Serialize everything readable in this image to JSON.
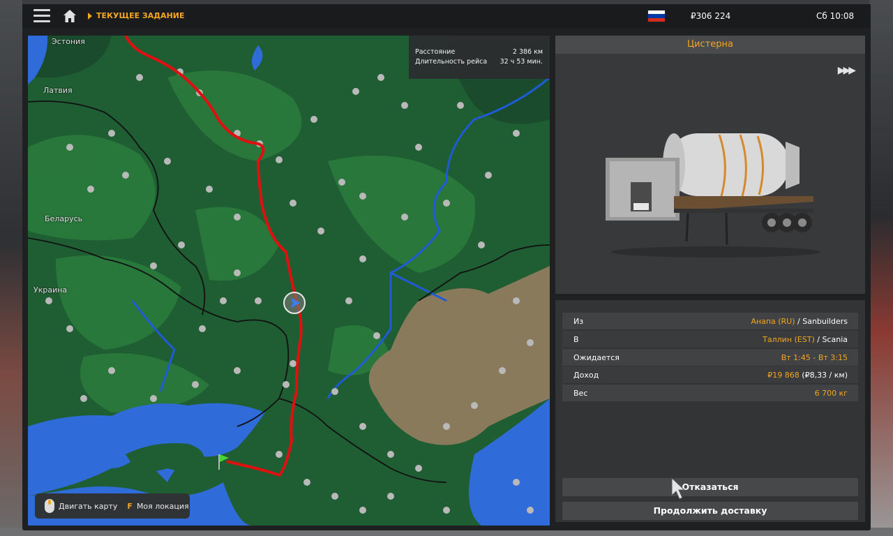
{
  "topbar": {
    "breadcrumb": "ТЕКУЩЕЕ ЗАДАНИЕ",
    "money": "₽306 224",
    "clock": "Сб 10:08",
    "flag_colors": [
      "#ffffff",
      "#0039a6",
      "#d52b1e"
    ]
  },
  "map": {
    "labels": {
      "estonia": "Эстония",
      "latvia": "Латвия",
      "belarus": "Беларусь",
      "ukraine": "Украина"
    },
    "info": {
      "distance_label": "Расстояние",
      "distance_value": "2 386 км",
      "duration_label": "Длительность рейса",
      "duration_value": "32 ч 53 мин."
    },
    "controls": {
      "move_label": "Двигать карту",
      "key": "F",
      "location_label": "Моя локация"
    },
    "colors": {
      "land": "#1f5d33",
      "water": "#2f6bd9",
      "route": "#e01010",
      "steppe": "#8a7a5c"
    }
  },
  "cargo": {
    "title": "Цистерна"
  },
  "details": {
    "from_label": "Из",
    "from_city": "Анапа (RU)",
    "from_company": " / Sanbuilders",
    "to_label": "В",
    "to_city": "Таллин (EST)",
    "to_company": " / Scania",
    "expected_label": "Ожидается",
    "expected_value": "Вт 1:45 - Вт 3:15",
    "income_label": "Доход",
    "income_value": "₽19 868",
    "income_rate": " (₽8,33 / км)",
    "weight_label": "Вес",
    "weight_value": "6 700 кг"
  },
  "buttons": {
    "decline": "Отказаться",
    "continue": "Продолжить доставку"
  },
  "accent_color": "#f5a623"
}
